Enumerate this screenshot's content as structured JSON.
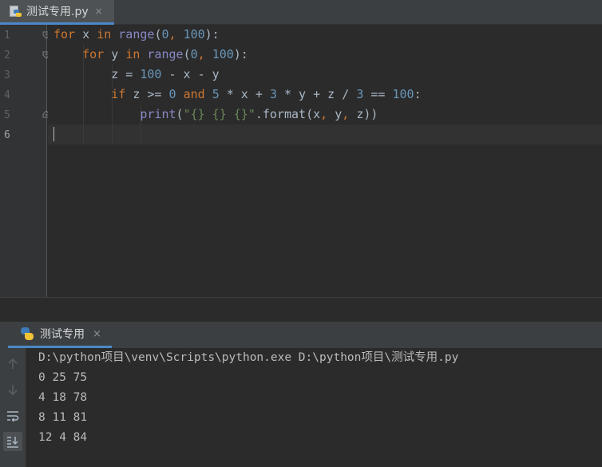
{
  "editor": {
    "tab": {
      "filename": "测试专用.py",
      "close_glyph": "×",
      "icon": "python-file-icon"
    },
    "line_numbers": [
      "1",
      "2",
      "3",
      "4",
      "5",
      "6"
    ],
    "lines": [
      [
        {
          "t": "for",
          "c": "kw"
        },
        {
          "t": " x ",
          "c": "plain"
        },
        {
          "t": "in",
          "c": "kw"
        },
        {
          "t": " ",
          "c": "plain"
        },
        {
          "t": "range",
          "c": "bi"
        },
        {
          "t": "(",
          "c": "plain"
        },
        {
          "t": "0",
          "c": "num"
        },
        {
          "t": ", ",
          "c": "kw"
        },
        {
          "t": "100",
          "c": "num"
        },
        {
          "t": "):",
          "c": "plain"
        }
      ],
      [
        {
          "t": "    ",
          "c": "plain"
        },
        {
          "t": "for",
          "c": "kw"
        },
        {
          "t": " y ",
          "c": "plain"
        },
        {
          "t": "in",
          "c": "kw"
        },
        {
          "t": " ",
          "c": "plain"
        },
        {
          "t": "range",
          "c": "bi"
        },
        {
          "t": "(",
          "c": "plain"
        },
        {
          "t": "0",
          "c": "num"
        },
        {
          "t": ", ",
          "c": "kw"
        },
        {
          "t": "100",
          "c": "num"
        },
        {
          "t": "):",
          "c": "plain"
        }
      ],
      [
        {
          "t": "        z = ",
          "c": "plain"
        },
        {
          "t": "100",
          "c": "num"
        },
        {
          "t": " - x - y",
          "c": "plain"
        }
      ],
      [
        {
          "t": "        ",
          "c": "plain"
        },
        {
          "t": "if",
          "c": "kw"
        },
        {
          "t": " z >= ",
          "c": "plain"
        },
        {
          "t": "0",
          "c": "num"
        },
        {
          "t": " ",
          "c": "plain"
        },
        {
          "t": "and",
          "c": "kw"
        },
        {
          "t": " ",
          "c": "plain"
        },
        {
          "t": "5",
          "c": "num"
        },
        {
          "t": " * x + ",
          "c": "plain"
        },
        {
          "t": "3",
          "c": "num"
        },
        {
          "t": " * y + z / ",
          "c": "plain"
        },
        {
          "t": "3",
          "c": "num"
        },
        {
          "t": " == ",
          "c": "plain"
        },
        {
          "t": "100",
          "c": "num"
        },
        {
          "t": ":",
          "c": "plain"
        }
      ],
      [
        {
          "t": "            ",
          "c": "plain"
        },
        {
          "t": "print",
          "c": "bi"
        },
        {
          "t": "(",
          "c": "plain"
        },
        {
          "t": "\"{} {} {}\"",
          "c": "str"
        },
        {
          "t": ".format(x",
          "c": "plain"
        },
        {
          "t": ", ",
          "c": "kw"
        },
        {
          "t": "y",
          "c": "plain"
        },
        {
          "t": ", ",
          "c": "kw"
        },
        {
          "t": "z))",
          "c": "plain"
        }
      ],
      []
    ],
    "current_line": "6"
  },
  "run_panel": {
    "tab_label": "测试专用",
    "close_glyph": "×",
    "tab_icon": "python-icon",
    "toolbar": [
      {
        "name": "scroll-up-icon",
        "active": false
      },
      {
        "name": "scroll-down-icon",
        "active": false
      },
      {
        "name": "soft-wrap-icon",
        "active": false
      },
      {
        "name": "scroll-to-end-icon",
        "active": true
      }
    ],
    "output": [
      "D:\\python项目\\venv\\Scripts\\python.exe D:\\python项目\\测试专用.py",
      "0 25 75",
      "4 18 78",
      "8 11 81",
      "12 4 84"
    ]
  },
  "colors": {
    "keyword": "#cc7832",
    "builtin": "#8888c6",
    "number": "#6897bb",
    "string": "#6a8759",
    "text": "#a9b7c6",
    "background": "#2b2b2b",
    "accent": "#4a88c7"
  }
}
